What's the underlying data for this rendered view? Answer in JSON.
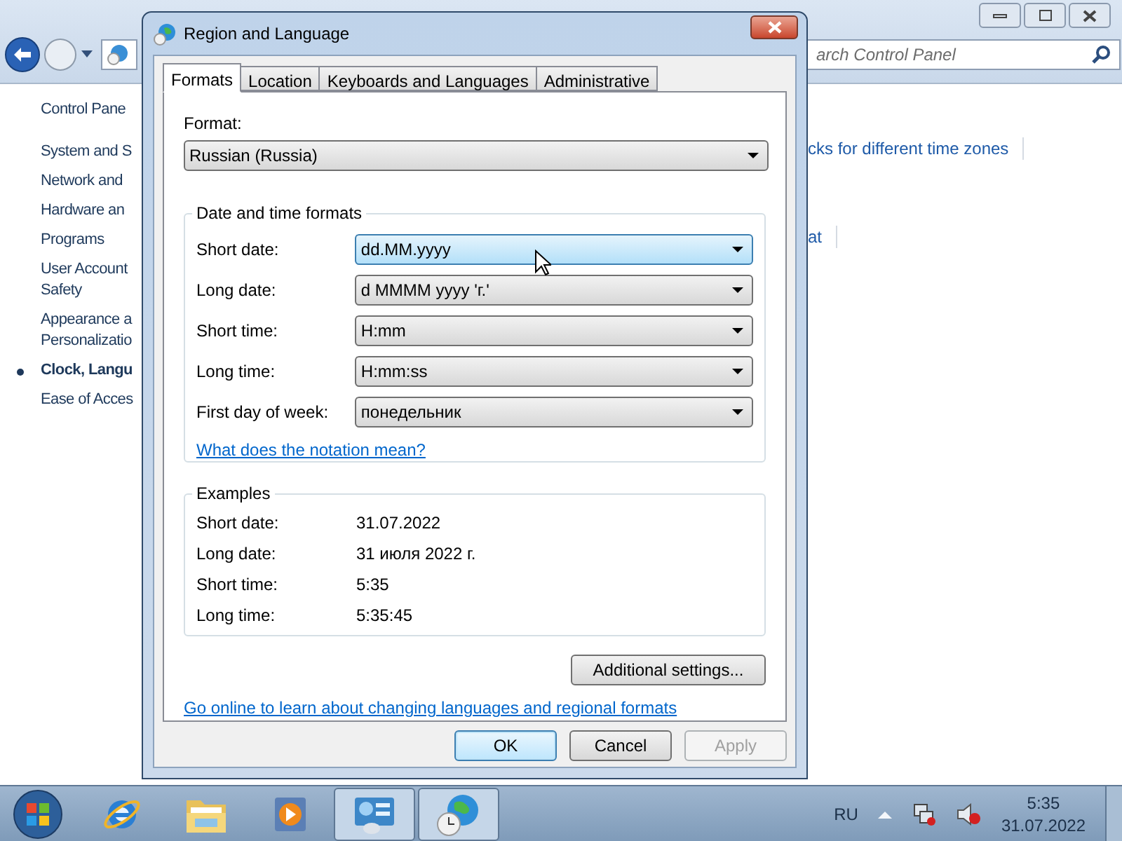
{
  "background_window": {
    "search_placeholder": "arch Control Panel",
    "sidebar": [
      {
        "lines": [
          "Control Pane"
        ],
        "selected": false,
        "kind": "home"
      },
      {
        "lines": [
          "System and S"
        ],
        "selected": false,
        "kind": "category"
      },
      {
        "lines": [
          "Network and"
        ],
        "selected": false,
        "kind": "category"
      },
      {
        "lines": [
          "Hardware an"
        ],
        "selected": false,
        "kind": "category"
      },
      {
        "lines": [
          "Programs"
        ],
        "selected": false,
        "kind": "category"
      },
      {
        "lines": [
          "User Account",
          "Safety"
        ],
        "selected": false,
        "kind": "category"
      },
      {
        "lines": [
          "Appearance a",
          "Personalizatio"
        ],
        "selected": false,
        "kind": "category"
      },
      {
        "lines": [
          "Clock, Langu"
        ],
        "selected": true,
        "kind": "category"
      },
      {
        "lines": [
          "Ease of Acces"
        ],
        "selected": false,
        "kind": "category"
      }
    ],
    "links": [
      "cks for different time zones",
      "at"
    ]
  },
  "dialog": {
    "title": "Region and Language",
    "tabs": [
      {
        "label": "Formats",
        "selected": true
      },
      {
        "label": "Location",
        "selected": false
      },
      {
        "label": "Keyboards and Languages",
        "selected": false
      },
      {
        "label": "Administrative",
        "selected": false
      }
    ],
    "format_label": "Format:",
    "format_value": "Russian (Russia)",
    "date_time_group": {
      "title": "Date and time formats",
      "rows": [
        {
          "label": "Short date:",
          "value": "dd.MM.yyyy",
          "hovered": true
        },
        {
          "label": "Long date:",
          "value": "d MMMM yyyy 'г.'",
          "hovered": false
        },
        {
          "label": "Short time:",
          "value": "H:mm",
          "hovered": false
        },
        {
          "label": "Long time:",
          "value": "H:mm:ss",
          "hovered": false
        },
        {
          "label": "First day of week:",
          "value": "понедельник",
          "hovered": false
        }
      ]
    },
    "notation_link": "What does the notation mean?",
    "examples": {
      "title": "Examples",
      "rows": [
        {
          "label": "Short date:",
          "value": "31.07.2022"
        },
        {
          "label": "Long date:",
          "value": "31 июля 2022 г."
        },
        {
          "label": "Short time:",
          "value": "5:35"
        },
        {
          "label": "Long time:",
          "value": "5:35:45"
        }
      ]
    },
    "additional_button": "Additional settings...",
    "online_link": "Go online to learn about changing languages and regional formats",
    "buttons": [
      {
        "label": "OK",
        "default": true,
        "disabled": false
      },
      {
        "label": "Cancel",
        "default": false,
        "disabled": false
      },
      {
        "label": "Apply",
        "default": false,
        "disabled": true
      }
    ]
  },
  "taskbar": {
    "apps": [
      {
        "kind": "ie",
        "active": false
      },
      {
        "kind": "folder",
        "active": false
      },
      {
        "kind": "media",
        "active": false
      },
      {
        "kind": "control-panel",
        "active": true
      },
      {
        "kind": "globe-clock",
        "active": true
      }
    ],
    "language": "RU",
    "time": "5:35",
    "date": "31.07.2022"
  }
}
